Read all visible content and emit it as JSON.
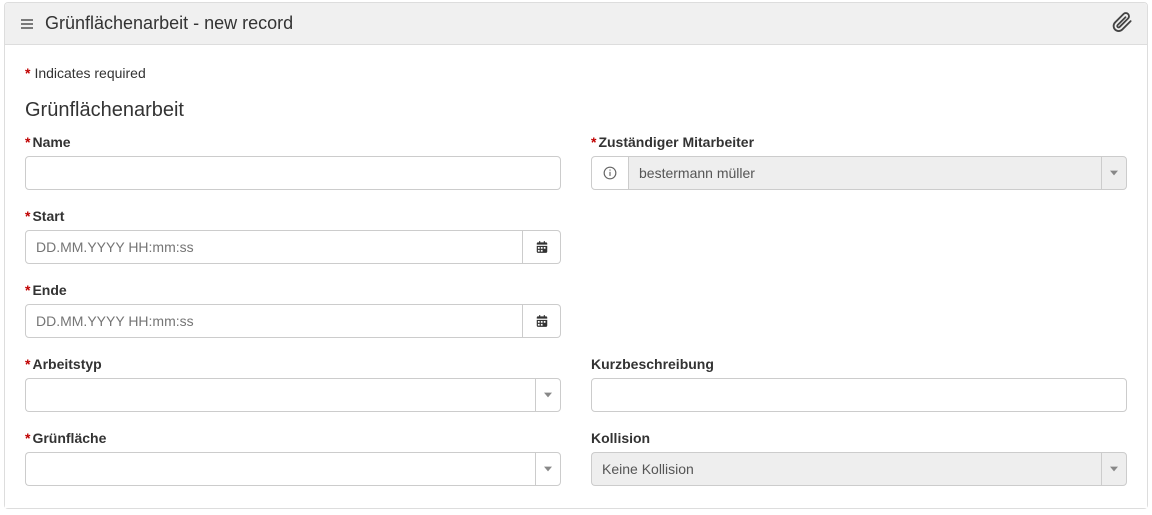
{
  "header": {
    "title": "Grünflächenarbeit - new record"
  },
  "required_note": "Indicates required",
  "section_title": "Grünflächenarbeit",
  "fields": {
    "name": {
      "label": "Name",
      "value": ""
    },
    "mitarbeiter": {
      "label": "Zuständiger Mitarbeiter",
      "value": "bestermann müller"
    },
    "start": {
      "label": "Start",
      "placeholder": "DD.MM.YYYY HH:mm:ss",
      "value": ""
    },
    "ende": {
      "label": "Ende",
      "placeholder": "DD.MM.YYYY HH:mm:ss",
      "value": ""
    },
    "arbeitstyp": {
      "label": "Arbeitstyp",
      "value": ""
    },
    "kurzbeschreibung": {
      "label": "Kurzbeschreibung",
      "value": ""
    },
    "gruenflaeche": {
      "label": "Grünfläche",
      "value": ""
    },
    "kollision": {
      "label": "Kollision",
      "value": "Keine Kollision"
    }
  }
}
